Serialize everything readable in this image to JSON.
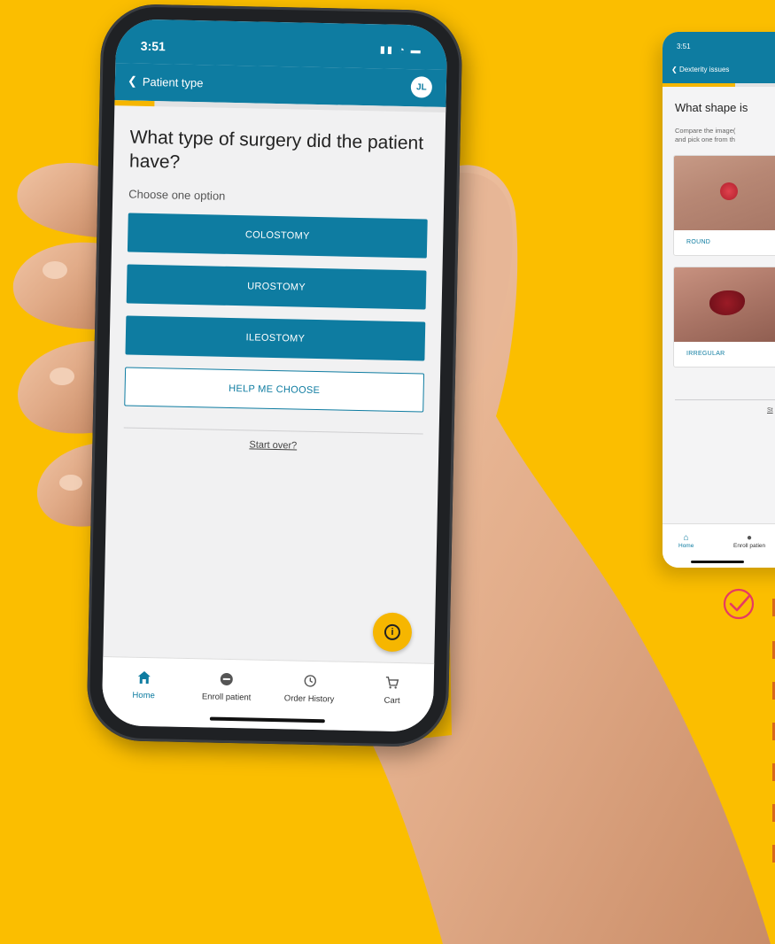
{
  "main_phone": {
    "status": {
      "time": "3:51"
    },
    "appbar": {
      "back_label": "Patient type",
      "avatar_initials": "JL"
    },
    "progress_fraction": 0.12,
    "question": "What type of surgery did the patient have?",
    "subtitle": "Choose one option",
    "options": [
      "COLOSTOMY",
      "UROSTOMY",
      "ILEOSTOMY"
    ],
    "help_button": "HELP ME CHOOSE",
    "start_over": "Start over?",
    "tabs": [
      {
        "label": "Home",
        "icon": "home-icon",
        "active": true
      },
      {
        "label": "Enroll patient",
        "icon": "enroll-icon",
        "active": false
      },
      {
        "label": "Order History",
        "icon": "history-icon",
        "active": false
      },
      {
        "label": "Cart",
        "icon": "cart-icon",
        "active": false
      }
    ]
  },
  "second_phone": {
    "status": {
      "time": "3:51"
    },
    "appbar": {
      "back_label": "Dexterity issues"
    },
    "question": "What shape is",
    "description": [
      "Compare the image(",
      "and pick one from th"
    ],
    "cards": [
      "ROUND",
      "IRREGULAR"
    ],
    "start_over": "St",
    "tabs": [
      "Home",
      "Enroll patien"
    ]
  },
  "colors": {
    "background": "#FBBE00",
    "primary": "#0e7ca1",
    "accent": "#F6B600",
    "check": "#E63A62"
  }
}
